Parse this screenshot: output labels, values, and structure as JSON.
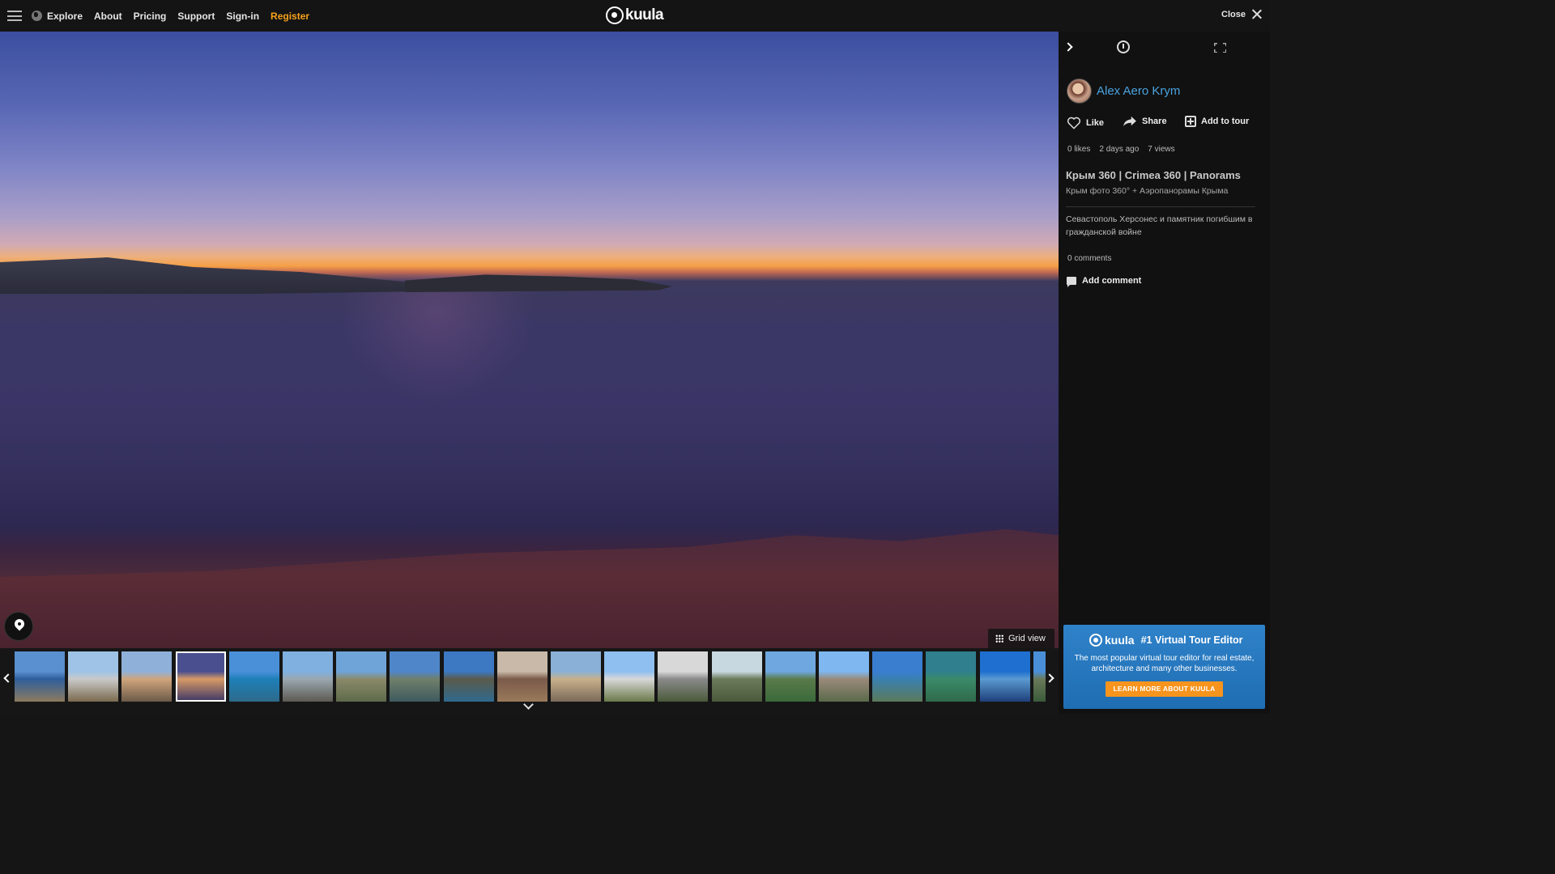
{
  "nav": {
    "items": [
      "Explore",
      "About",
      "Pricing",
      "Support",
      "Sign-in",
      "Register"
    ],
    "register_color": "#f7a21b"
  },
  "logo": {
    "text": "kuula"
  },
  "close_label": "Close",
  "viewer": {
    "grid_view_label": "Grid view"
  },
  "filmstrip": {
    "active_index": 3,
    "thumbs": [
      [
        "#5a8fd0",
        "#2f5e9c",
        "#8c7a5e"
      ],
      [
        "#9fc3e6",
        "#c9c9c9",
        "#7b6a4f"
      ],
      [
        "#8fb1d9",
        "#cfa57c",
        "#6b5a48"
      ],
      [
        "#4a4f8f",
        "#d79a66",
        "#3a3566"
      ],
      [
        "#4a90d9",
        "#1e7fb8",
        "#2d6a8a"
      ],
      [
        "#7fb0e0",
        "#9aa7b0",
        "#5d5a52"
      ],
      [
        "#6fa4d8",
        "#8a8a6a",
        "#5e6a4a"
      ],
      [
        "#4f86c9",
        "#6f7f6a",
        "#3e5a5e"
      ],
      [
        "#3d78c2",
        "#5a5a4a",
        "#2f6a8f"
      ],
      [
        "#c9b9a8",
        "#7a5a4a",
        "#9a7a5a"
      ],
      [
        "#8ab0d8",
        "#c8b08a",
        "#7a6a5a"
      ],
      [
        "#8fbff0",
        "#d8d8d8",
        "#6a7a4a"
      ],
      [
        "#d8d8d8",
        "#8a8a8a",
        "#4a5a3a"
      ],
      [
        "#c8d8e0",
        "#6a7a5a",
        "#4a5a3a"
      ],
      [
        "#6fa8e0",
        "#5a7a4a",
        "#3a6a3a"
      ],
      [
        "#7fb8f0",
        "#9a8a7a",
        "#5a6a4a"
      ],
      [
        "#3a7ed0",
        "#3a80b0",
        "#5a7a5a"
      ],
      [
        "#2f7f8f",
        "#3a8a6a",
        "#2f6a4a"
      ],
      [
        "#1e6fd0",
        "#5a9ad0",
        "#1e3f7a"
      ],
      [
        "#4a90d9",
        "#6a7a5a",
        "#3a5a3a"
      ]
    ]
  },
  "sidebar": {
    "author": "Alex Aero Krym",
    "actions": {
      "like": "Like",
      "share": "Share",
      "add_to_tour": "Add to tour"
    },
    "stats": {
      "likes": "0 likes",
      "date": "2 days ago",
      "views": "7 views"
    },
    "album_title": "Крым 360 | Crimea 360 | Panorams",
    "album_subtitle": "Крым фото 360° + Аэропанорамы Крыма",
    "description": "Севастополь Херсонес и памятник погибшим в гражданской войне",
    "comments_count": "0 comments",
    "add_comment": "Add comment",
    "link_color": "#4aa3df"
  },
  "promo": {
    "logo": "kuula",
    "tagline": "#1 Virtual Tour Editor",
    "text": "The most popular virtual tour editor for real estate, architecture and many other businesses.",
    "button": "LEARN MORE ABOUT KUULA",
    "bg_color": "#2a7cc4",
    "button_color": "#f7941d"
  }
}
